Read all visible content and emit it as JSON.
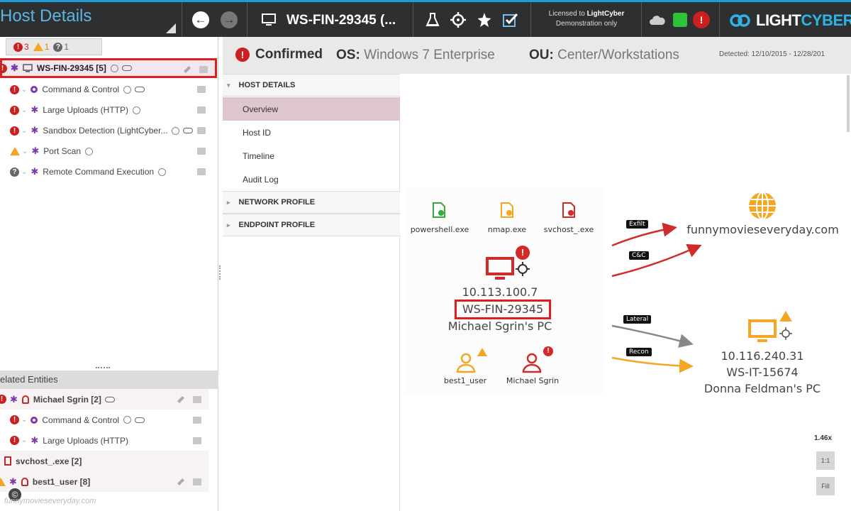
{
  "app": {
    "title": "Host Details",
    "host_title": "WS-FIN-29345 (...",
    "license_line1_prefix": "Licensed to ",
    "license_brand": "LightCyber",
    "license_line2": "Demonstration only",
    "logo_prefix": "LIGHT",
    "logo_suffix": "CYBER"
  },
  "counts": {
    "critical": "3",
    "warning": "1",
    "unknown": "1"
  },
  "tree": {
    "root": {
      "label": "WS-FIN-29345 [5]"
    },
    "items": [
      {
        "label": "Command & Control"
      },
      {
        "label": "Large Uploads (HTTP)"
      },
      {
        "label": "Sandbox Detection (LightCyber..."
      },
      {
        "label": "Port Scan"
      },
      {
        "label": "Remote Command Execution"
      }
    ]
  },
  "related": {
    "header": "elated Entities",
    "items": [
      {
        "label": "Michael Sgrin [2]"
      },
      {
        "label": "Command & Control"
      },
      {
        "label": "Large Uploads (HTTP)"
      },
      {
        "label": "svchost_.exe [2]"
      },
      {
        "label": "best1_user [8]"
      }
    ]
  },
  "watermark": "funnymovieseveryday.com",
  "copyright": "©",
  "header": {
    "status": "Confirmed",
    "os_label": "OS:",
    "os_value": "Windows 7 Enterprise",
    "ou_label": "OU:",
    "ou_value": "Center/Workstations",
    "detected": "Detected: 12/10/2015 - 12/28/201"
  },
  "nav": {
    "sections": [
      "HOST DETAILS",
      "NETWORK PROFILE",
      "ENDPOINT PROFILE"
    ],
    "items": [
      "Overview",
      "Host ID",
      "Timeline",
      "Audit Log"
    ]
  },
  "graph": {
    "processes": [
      "powershell.exe",
      "nmap.exe",
      "svchost_.exe"
    ],
    "host_ip": "10.113.100.7",
    "host_name": "WS-FIN-29345",
    "host_owner": "Michael Sgrin's PC",
    "users": [
      "best1_user",
      "Michael Sgrin"
    ],
    "edges": [
      "Exfilt",
      "C&C",
      "Lateral",
      "Recon"
    ],
    "domain": "funnymovieseveryday.com",
    "target_ip": "10.116.240.31",
    "target_name": "WS-IT-15674",
    "target_owner": "Donna Feldman's PC",
    "zoom": "1.46x",
    "zoom_buttons": [
      "1:1",
      "Fill"
    ]
  },
  "colors": {
    "accent": "#1d9bd6",
    "critical": "#cc1f1f",
    "warning": "#f5a623",
    "threat_purple": "#7c3aa8",
    "selection_red": "#e01d1d"
  }
}
